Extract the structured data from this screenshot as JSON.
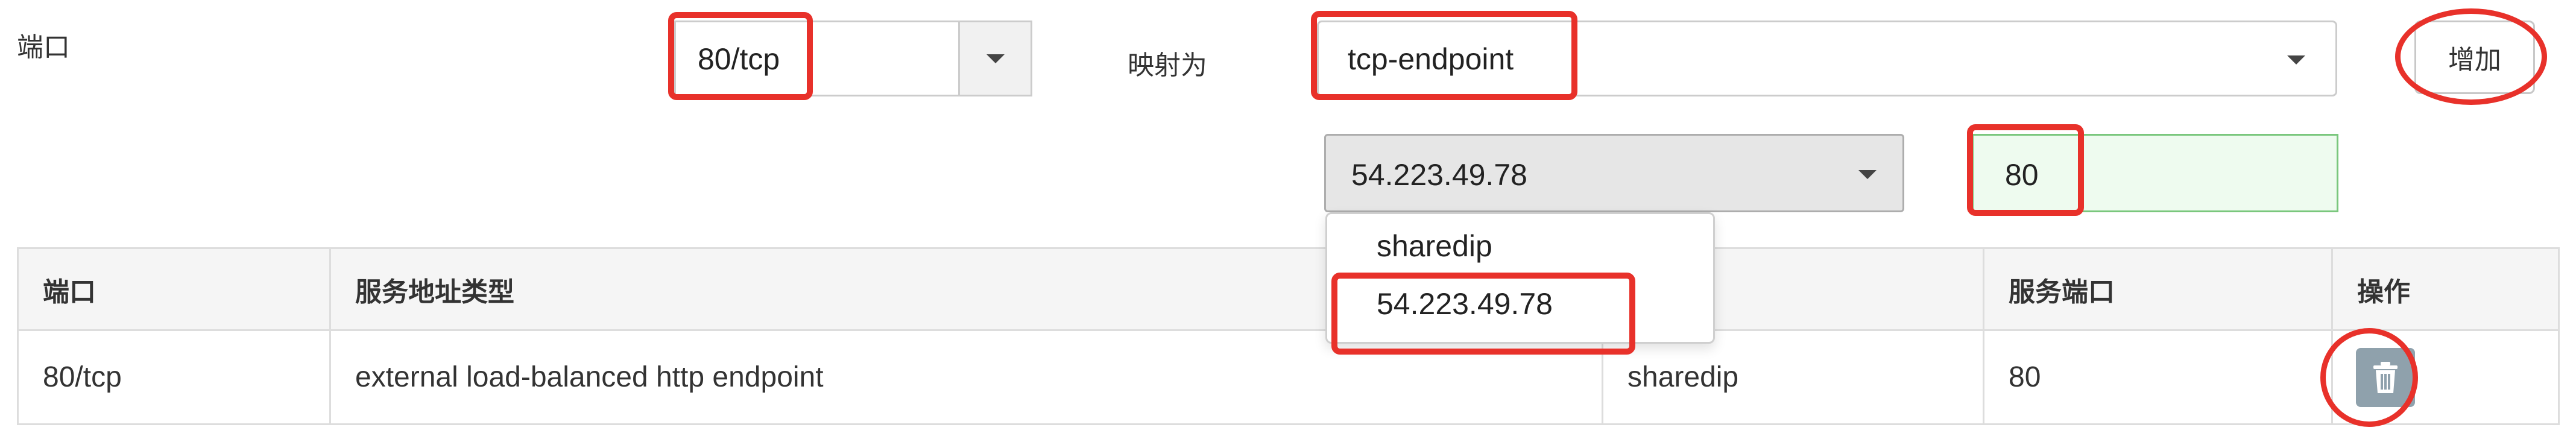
{
  "form": {
    "port_label": "端口",
    "port_value": "80/tcp",
    "map_label": "映射为",
    "endpoint_value": "tcp-endpoint",
    "add_button": "增加",
    "ip_value": "54.223.49.78",
    "service_port_value": "80"
  },
  "dropdown": {
    "options": [
      "sharedip",
      "54.223.49.78"
    ]
  },
  "table": {
    "headers": [
      "端口",
      "服务地址类型",
      "",
      "服务端口",
      "操作"
    ],
    "rows": [
      {
        "port": "80/tcp",
        "type": "external load-balanced http endpoint",
        "address": "sharedip",
        "service_port": "80"
      }
    ]
  },
  "icons": {
    "caret": "chevron-down-icon",
    "delete": "trash-icon"
  },
  "colors": {
    "highlight": "#e8312a",
    "input_valid": "#eefbef",
    "delete_button": "#8fa1ac"
  }
}
